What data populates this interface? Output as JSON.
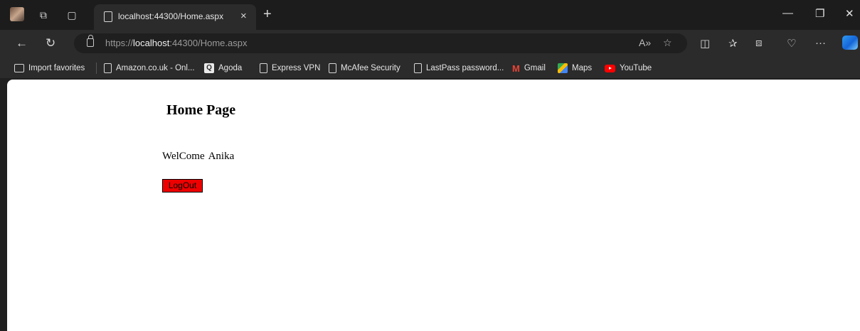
{
  "browser": {
    "tab": {
      "title": "localhost:44300/Home.aspx",
      "close": "×"
    },
    "new_tab": "+",
    "controls": {
      "minimize": "—",
      "restore": "❐",
      "close": "✕"
    },
    "address": {
      "scheme": "https://",
      "host": "localhost",
      "rest": ":44300/Home.aspx"
    },
    "favorites": [
      {
        "label": "Import favorites",
        "icon": "import-icon"
      },
      {
        "label": "Amazon.co.uk - Onl...",
        "icon": "page-icon"
      },
      {
        "label": "Agoda",
        "icon": "agoda-icon"
      },
      {
        "label": "Express VPN",
        "icon": "page-icon"
      },
      {
        "label": "McAfee Security",
        "icon": "page-icon"
      },
      {
        "label": "LastPass password...",
        "icon": "page-icon"
      },
      {
        "label": "Gmail",
        "icon": "gmail-icon"
      },
      {
        "label": "Maps",
        "icon": "maps-icon"
      },
      {
        "label": "YouTube",
        "icon": "youtube-icon"
      }
    ]
  },
  "page": {
    "title": "Home Page",
    "welcome_text": "WelCome",
    "user_name": "Anika",
    "logout_label": "LogOut"
  },
  "colors": {
    "logout_bg": "#ee0000",
    "chrome_dark": "#2b2b2b"
  }
}
